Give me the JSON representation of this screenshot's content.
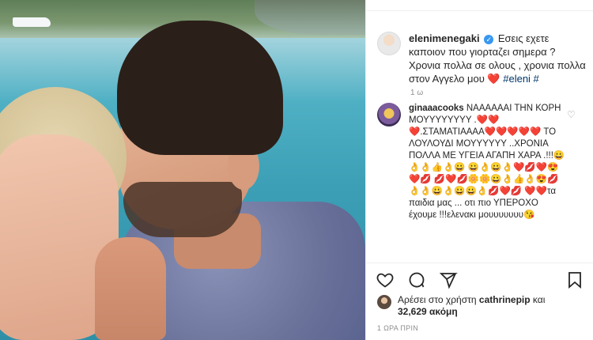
{
  "caption": {
    "username": "elenimenegaki",
    "text": "Εσεις εχετε καποιον που γιορταζει σημερα ? Χρονια πολλα σε ολους , χρονια πολλα στον Αγγελο μου ❤️",
    "hashtag": "#eleni #",
    "time": "1 ω"
  },
  "comment": {
    "username": "ginaaacooks",
    "text": "ΝΑΑΑΑΑΑΙ ΤΗΝ ΚΟΡΗ ΜΟΥΥΥΥΥΥΥΥ .❤️❤️ ❤️.ΣΤΑΜΑΤΙΑΑΑΑ❤️❤️❤️❤️❤️ ΤΟ ΛΟΥΛΟΥΔΙ ΜΟΥΥΥΥΥΥ ..ΧΡΟΝΙΑ ΠΟΛΛΑ ΜΕ ΥΓΕΙΑ ΑΓΑΠΗ ΧΑΡΑ .!!!😀👌👌👍👌😀 😀👌😀👌❤️💋❤️😍❤️💋 💋❤️💋🌼🌼😀👌👍👌😍💋 👌👌😀👌😀😀👌💋❤️💋 ❤️❤️τα παιδια μας ... οτι πιο ΥΠΕΡΟΧΟ έχουμε !!!ελενακι μουυυυυυυ😘"
  },
  "likes": {
    "prefix": "Αρέσει στο χρήστη",
    "user": "cathrinepip",
    "middle": "και",
    "count": "32,629 ακόμη"
  },
  "post_time": "1 ΩΡΑ ΠΡΙΝ",
  "icons": {
    "like": "heart-icon",
    "comment": "comment-icon",
    "share": "share-icon",
    "save": "bookmark-icon",
    "verified": "verified-badge-icon"
  },
  "verified_glyph": "✓",
  "comment_heart_glyph": "♡"
}
